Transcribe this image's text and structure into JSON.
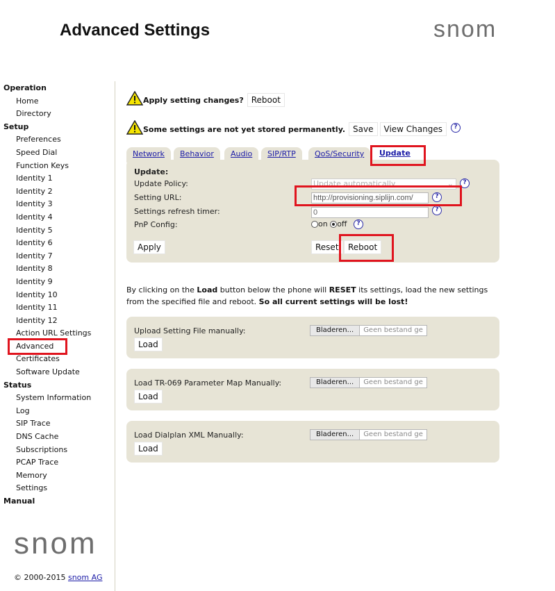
{
  "header": {
    "title": "Advanced Settings",
    "logo": "snom"
  },
  "sidebar": {
    "sections": [
      {
        "heading": "Operation",
        "items": [
          "Home",
          "Directory"
        ]
      },
      {
        "heading": "Setup",
        "items": [
          "Preferences",
          "Speed Dial",
          "Function Keys",
          "Identity 1",
          "Identity 2",
          "Identity 3",
          "Identity 4",
          "Identity 5",
          "Identity 6",
          "Identity 7",
          "Identity 8",
          "Identity 9",
          "Identity 10",
          "Identity 11",
          "Identity 12",
          "Action URL Settings",
          "Advanced",
          "Certificates",
          "Software Update"
        ]
      },
      {
        "heading": "Status",
        "items": [
          "System Information",
          "Log",
          "SIP Trace",
          "DNS Cache",
          "Subscriptions",
          "PCAP Trace",
          "Memory",
          "Settings"
        ]
      },
      {
        "heading": "Manual",
        "items": []
      }
    ],
    "active_item": "Advanced",
    "logo": "snom",
    "copyright_prefix": "© 2000-2015",
    "copyright_link": "snom AG"
  },
  "warnings": {
    "apply_text": "Apply setting changes?",
    "apply_reboot_label": "Reboot",
    "store_text": "Some settings are not yet stored permanently.",
    "save_label": "Save",
    "view_changes_label": "View Changes"
  },
  "tabs": [
    "Network",
    "Behavior",
    "Audio",
    "SIP/RTP",
    "QoS/Security",
    "Update"
  ],
  "active_tab": "Update",
  "update_form": {
    "heading": "Update:",
    "policy_label": "Update Policy:",
    "policy_value": "Update automatically",
    "url_label": "Setting URL:",
    "url_value": "http://provisioning.siplijn.com/",
    "timer_label": "Settings refresh timer:",
    "timer_value": "0",
    "pnp_label": "PnP Config:",
    "pnp_on_label": "on",
    "pnp_off_label": "off",
    "pnp_selected": "off",
    "apply_label": "Apply",
    "reset_label": "Reset",
    "reboot_label": "Reboot"
  },
  "info": {
    "part1": "By clicking on the ",
    "load_word": "Load",
    "part2": " button below the phone will ",
    "reset_word": "RESET",
    "part3": " its settings, load the new settings from the specified file and reboot. ",
    "warning": "So all current settings will be lost!"
  },
  "uploads": [
    {
      "label": "Upload Setting File manually:",
      "browse_label": "Bladeren...",
      "no_file_text": "Geen bestand ge",
      "load_label": "Load"
    },
    {
      "label": "Load TR-069 Parameter Map Manually:",
      "browse_label": "Bladeren...",
      "no_file_text": "Geen bestand ge",
      "load_label": "Load"
    },
    {
      "label": "Load Dialplan XML Manually:",
      "browse_label": "Bladeren...",
      "no_file_text": "Geen bestand ge",
      "load_label": "Load"
    }
  ],
  "colors": {
    "panel_bg": "#e7e4d6",
    "highlight_red": "#e0141e",
    "link_blue": "#1a1aa6",
    "logo_gray": "#6e6e6e"
  }
}
